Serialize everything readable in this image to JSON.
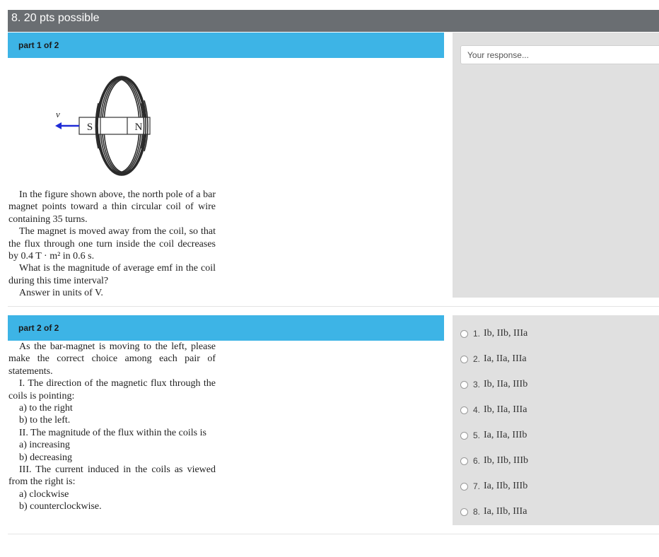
{
  "question": {
    "header": "8. 20 pts possible"
  },
  "part1": {
    "label": "part 1 of 2",
    "response_placeholder": "Your response...",
    "figure": {
      "vector_label": "v⃗",
      "south_label": "S",
      "north_label": "N",
      "arrow_color": "#1f2bd6"
    },
    "text": {
      "p1": "In the figure shown above, the north pole of a bar magnet points toward a thin circular coil of wire containing 35 turns.",
      "p2": "The magnet is moved away from the coil, so that the flux through one turn inside the coil decreases by 0.4 T · m² in 0.6 s.",
      "p3": "What is the magnitude of average emf in the coil during this time interval?",
      "p4": "Answer in units of  V."
    }
  },
  "part2": {
    "label": "part 2 of 2",
    "text": {
      "intro": "As the bar-magnet is moving to the left, please make the correct choice among each pair of statements.",
      "s1": "I. The direction of the magnetic flux through the coils is pointing:",
      "s1a": "a) to the right",
      "s1b": "b) to the left.",
      "s2": "II. The magnitude of the flux within the coils is",
      "s2a": "a) increasing",
      "s2b": "b) decreasing",
      "s3": "III. The current induced in the coils as viewed from the right is:",
      "s3a": "a) clockwise",
      "s3b": "b) counterclockwise."
    },
    "choices": [
      {
        "num": "1.",
        "text": "Ib, IIb, IIIa"
      },
      {
        "num": "2.",
        "text": "Ia, IIa, IIIa"
      },
      {
        "num": "3.",
        "text": "Ib, IIa, IIIb"
      },
      {
        "num": "4.",
        "text": "Ib, IIa, IIIa"
      },
      {
        "num": "5.",
        "text": "Ia, IIa, IIIb"
      },
      {
        "num": "6.",
        "text": "Ib, IIb, IIIb"
      },
      {
        "num": "7.",
        "text": "Ia, IIb, IIIb"
      },
      {
        "num": "8.",
        "text": "Ia, IIb, IIIa"
      }
    ]
  },
  "colors": {
    "header_bg": "#6a6e72",
    "part_bar": "#3db4e6",
    "panel_bg": "#e0e0e0"
  }
}
